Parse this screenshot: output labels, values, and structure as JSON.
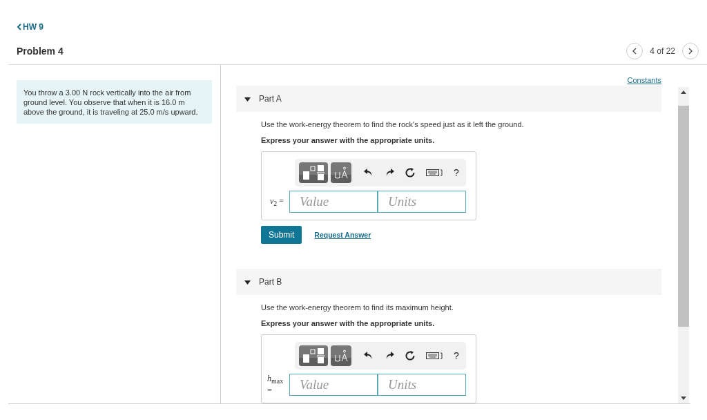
{
  "header": {
    "back_link": "HW 9",
    "title": "Problem 4",
    "pager": "4 of 22"
  },
  "problem_text": "You throw a 3.00 N rock vertically into the air from ground level. You observe that when it is 16.0 m above the ground, it is traveling at 25.0 m/s upward.",
  "constants_link": "Constants",
  "parts": [
    {
      "title": "Part A",
      "expanded": true,
      "instruction": "Use the work-energy theorem to find the rock's speed just as it left the ground.",
      "express": "Express your answer with the appropriate units.",
      "toolbar_help": "?",
      "answer_label": "*v*$_{2}$ =",
      "value": {
        "placeholder": "Value"
      },
      "units": {
        "placeholder": "Units"
      },
      "submit": "Submit",
      "request": "Request Answer"
    },
    {
      "title": "Part B",
      "expanded": true,
      "instruction": "Use the work-energy theorem to find its maximum height.",
      "express": "Express your answer with the appropriate units.",
      "toolbar_help": "?",
      "answer_label": "*h*$_{max}$ =",
      "value": {
        "placeholder": "Value"
      },
      "units": {
        "placeholder": "Units"
      }
    }
  ]
}
